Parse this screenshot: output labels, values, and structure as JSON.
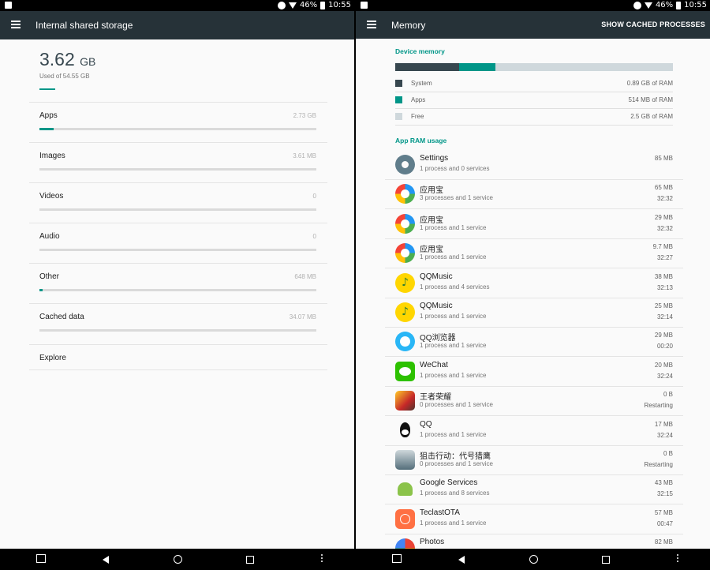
{
  "status_bar": {
    "battery": "46%",
    "time": "10:55"
  },
  "left": {
    "title": "Internal shared storage",
    "used_value": "3.62",
    "used_unit": "GB",
    "used_of": "Used of 54.55 GB",
    "used_fraction": 0.066,
    "categories": [
      {
        "label": "Apps",
        "value": "2.73 GB",
        "fraction": 0.05
      },
      {
        "label": "Images",
        "value": "3.61 MB",
        "fraction": 0.0
      },
      {
        "label": "Videos",
        "value": "0",
        "fraction": 0.0
      },
      {
        "label": "Audio",
        "value": "0",
        "fraction": 0.0
      },
      {
        "label": "Other",
        "value": "648 MB",
        "fraction": 0.01
      },
      {
        "label": "Cached data",
        "value": "34.07 MB",
        "fraction": 0.0
      }
    ],
    "explore": "Explore"
  },
  "right": {
    "title": "Memory",
    "action": "SHOW CACHED PROCESSES",
    "device_memory_title": "Device memory",
    "memory_bar": [
      {
        "name": "System",
        "fraction": 0.23,
        "color": "#37474f"
      },
      {
        "name": "Apps",
        "fraction": 0.13,
        "color": "#009688"
      },
      {
        "name": "Free",
        "fraction": 0.64,
        "color": "#cfd8dc"
      }
    ],
    "legend": [
      {
        "label": "System",
        "value": "0.89 GB of RAM",
        "color": "#37474f"
      },
      {
        "label": "Apps",
        "value": "514 MB of RAM",
        "color": "#009688"
      },
      {
        "label": "Free",
        "value": "2.5 GB of RAM",
        "color": "#cfd8dc"
      }
    ],
    "app_ram_title": "App RAM usage",
    "apps": [
      {
        "name": "Settings",
        "sub": "1 process and 0 services",
        "mem": "85 MB",
        "time": "",
        "icon": "settings-icon"
      },
      {
        "name": "应用宝",
        "sub": "3 processes and 1 service",
        "mem": "65 MB",
        "time": "32:32",
        "icon": "yyb-icon"
      },
      {
        "name": "应用宝",
        "sub": "1 process and 1 service",
        "mem": "29 MB",
        "time": "32:32",
        "icon": "yyb-icon"
      },
      {
        "name": "应用宝",
        "sub": "1 process and 1 service",
        "mem": "9.7 MB",
        "time": "32:27",
        "icon": "yyb-icon"
      },
      {
        "name": "QQMusic",
        "sub": "1 process and 4 services",
        "mem": "38 MB",
        "time": "32:13",
        "icon": "qqmusic-icon"
      },
      {
        "name": "QQMusic",
        "sub": "1 process and 1 service",
        "mem": "25 MB",
        "time": "32:14",
        "icon": "qqmusic-icon"
      },
      {
        "name": "QQ浏览器",
        "sub": "1 process and 1 service",
        "mem": "29 MB",
        "time": "00:20",
        "icon": "qqbrowser-icon"
      },
      {
        "name": "WeChat",
        "sub": "1 process and 1 service",
        "mem": "20 MB",
        "time": "32:24",
        "icon": "wechat-icon"
      },
      {
        "name": "王者荣耀",
        "sub": "0 processes and 1 service",
        "mem": "0 B",
        "time": "Restarting",
        "icon": "wzry-icon"
      },
      {
        "name": "QQ",
        "sub": "1 process and 1 service",
        "mem": "17 MB",
        "time": "32:24",
        "icon": "qq-icon"
      },
      {
        "name": "狙击行动：代号猎鹰",
        "sub": "0 processes and 1 service",
        "mem": "0 B",
        "time": "Restarting",
        "icon": "game-icon"
      },
      {
        "name": "Google Services",
        "sub": "1 process and 8 services",
        "mem": "43 MB",
        "time": "32:15",
        "icon": "gservices-icon"
      },
      {
        "name": "TeclastOTA",
        "sub": "1 process and 1 service",
        "mem": "57 MB",
        "time": "00:47",
        "icon": "teclast-icon"
      },
      {
        "name": "Photos",
        "sub": "",
        "mem": "82 MB",
        "time": "",
        "icon": "photos-icon"
      }
    ]
  }
}
